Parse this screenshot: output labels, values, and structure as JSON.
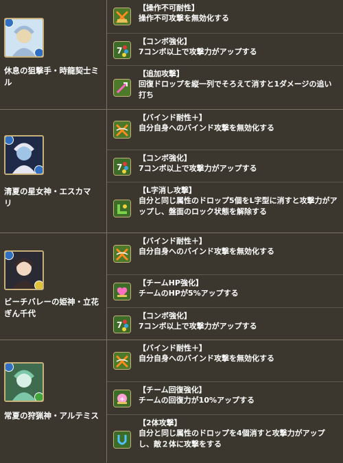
{
  "colors": {
    "background": "#3b372f",
    "border": "#7a7466",
    "text": "#ffffff",
    "icon_frame": "#c9b27a",
    "water": "#2f6fc4",
    "light": "#e0c23a",
    "wood": "#3fa53a"
  },
  "characters": [
    {
      "name": "休息の狙撃手・時龍契士ミル",
      "main_attribute": "water",
      "sub_attribute": "water",
      "awakenings": [
        {
          "icon": "skill-lock-resist-icon",
          "title": "【操作不可耐性】",
          "desc": "操作不可攻撃を無効化する"
        },
        {
          "icon": "seven-combo-icon",
          "title": "【コンボ強化】",
          "desc": "7コンボ以上で攻撃力がアップする"
        },
        {
          "icon": "additional-attack-icon",
          "title": "【追加攻撃】",
          "desc": "回復ドロップを縦一列でそろえて消すと1ダメージの追い打ち"
        }
      ]
    },
    {
      "name": "清夏の星女神・エスカマリ",
      "main_attribute": "water",
      "sub_attribute": "water",
      "awakenings": [
        {
          "icon": "bind-resist-plus-icon",
          "title": "【バインド耐性＋】",
          "desc": "自分自身へのバインド攻撃を無効化する"
        },
        {
          "icon": "seven-combo-icon",
          "title": "【コンボ強化】",
          "desc": "7コンボ以上で攻撃力がアップする"
        },
        {
          "icon": "l-shape-icon",
          "title": "【L字消し攻撃】",
          "desc": "自分と同じ属性のドロップ5個をL字型に消すと攻撃力がアップし、盤面のロック状態を解除する"
        }
      ]
    },
    {
      "name": "ビーチバレーの姫神・立花ぎん千代",
      "main_attribute": "water",
      "sub_attribute": "light",
      "awakenings": [
        {
          "icon": "bind-resist-plus-icon",
          "title": "【バインド耐性＋】",
          "desc": "自分自身へのバインド攻撃を無効化する"
        },
        {
          "icon": "team-hp-icon",
          "title": "【チームHP強化】",
          "desc": "チームのHPが5%アップする"
        },
        {
          "icon": "seven-combo-icon",
          "title": "【コンボ強化】",
          "desc": "7コンボ以上で攻撃力がアップする"
        }
      ]
    },
    {
      "name": "常夏の狩猟神・アルテミス",
      "main_attribute": "water",
      "sub_attribute": "wood",
      "awakenings": [
        {
          "icon": "bind-resist-plus-icon",
          "title": "【バインド耐性＋】",
          "desc": "自分自身へのバインド攻撃を無効化する"
        },
        {
          "icon": "team-rcv-icon",
          "title": "【チーム回復強化】",
          "desc": "チームの回復力が10%アップする"
        },
        {
          "icon": "two-pronged-icon",
          "title": "【2体攻撃】",
          "desc": "自分と同じ属性のドロップを4個消すと攻撃力がアップし、敵２体に攻撃をする"
        }
      ]
    }
  ]
}
